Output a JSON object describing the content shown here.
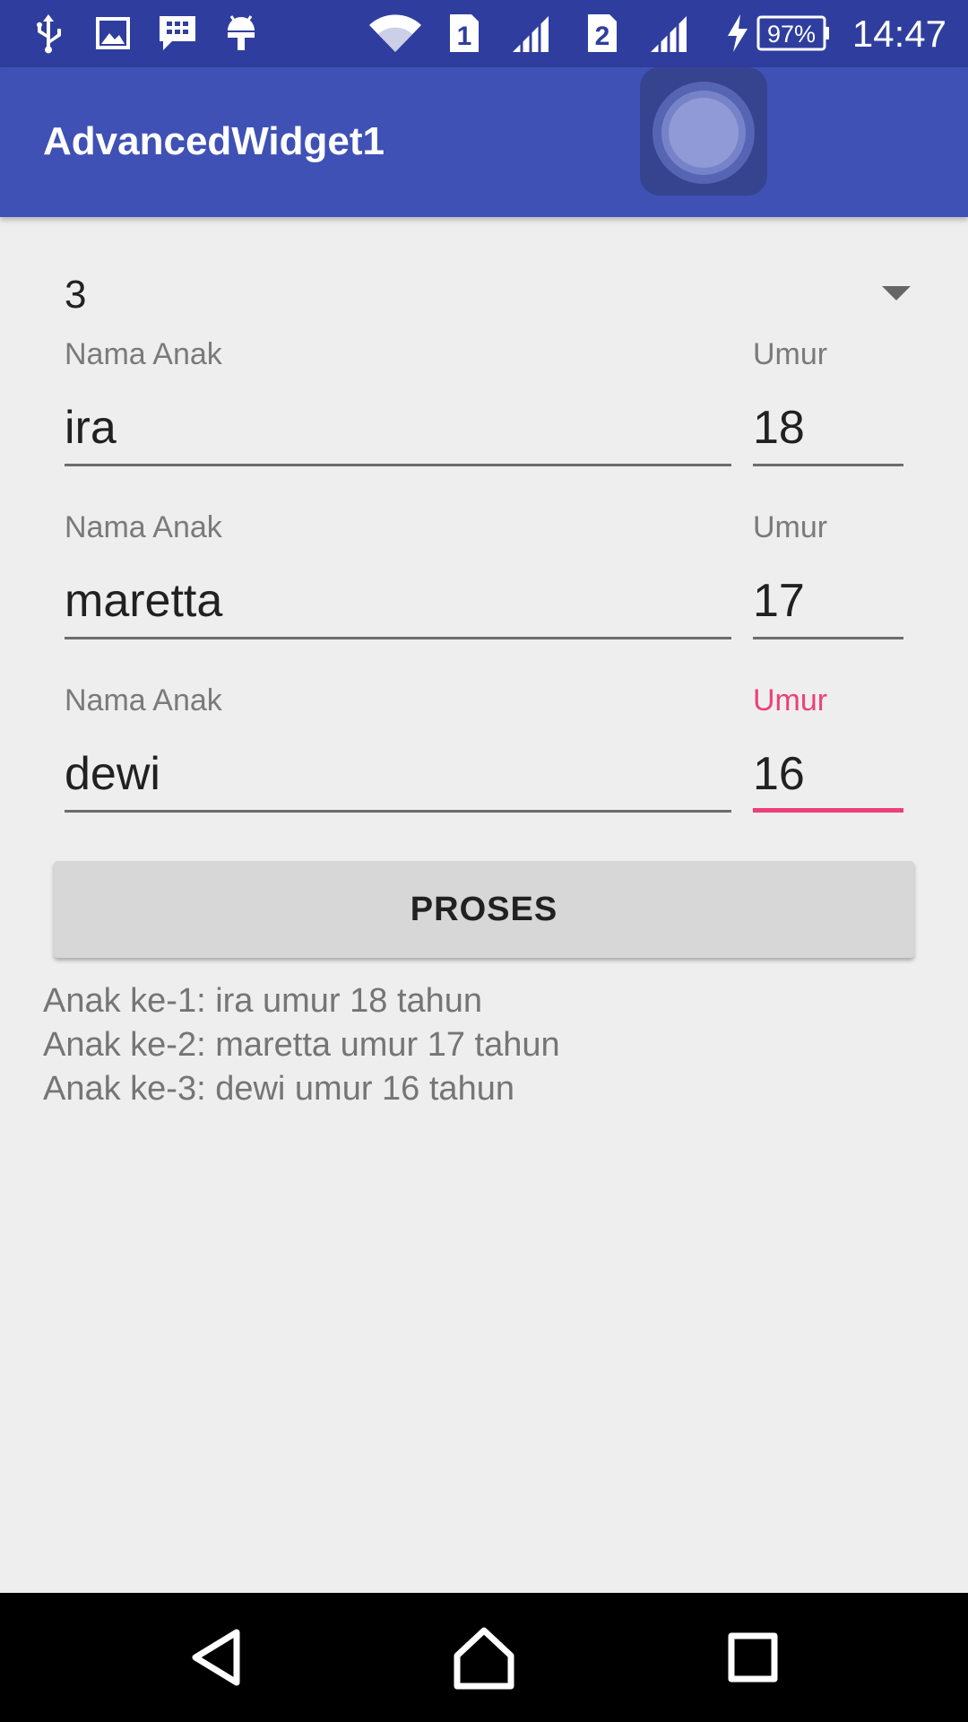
{
  "status_bar": {
    "icons": [
      "usb-icon",
      "image-icon",
      "bbm-icon",
      "android-debug-icon",
      "wifi-icon",
      "sim1-signal-icon",
      "sim2-signal-icon",
      "charging-icon",
      "battery-icon"
    ],
    "sim1_label": "1",
    "sim2_label": "2",
    "battery_level": "97%",
    "time": "14:47"
  },
  "app_bar": {
    "title": "AdvancedWidget1"
  },
  "spinner": {
    "selected_value": "3"
  },
  "children": [
    {
      "name_label": "Nama Anak",
      "name_value": "ira",
      "age_label": "Umur",
      "age_value": "18"
    },
    {
      "name_label": "Nama Anak",
      "name_value": "maretta",
      "age_label": "Umur",
      "age_value": "17"
    },
    {
      "name_label": "Nama Anak",
      "name_value": "dewi",
      "age_label": "Umur",
      "age_value": "16"
    }
  ],
  "focused_field": "children.2.age",
  "button": {
    "label": "PROSES"
  },
  "result": {
    "lines": [
      "Anak ke-1: ira umur 18 tahun",
      "Anak ke-2: maretta umur 17 tahun",
      "Anak ke-3: dewi umur 16 tahun"
    ]
  },
  "nav_bar": {
    "buttons": [
      "back-icon",
      "home-icon",
      "recents-icon"
    ]
  },
  "colors": {
    "status_bar": "#2f3e9e",
    "app_bar": "#3f51b5",
    "accent": "#ec407a",
    "background": "#eeeeee"
  }
}
